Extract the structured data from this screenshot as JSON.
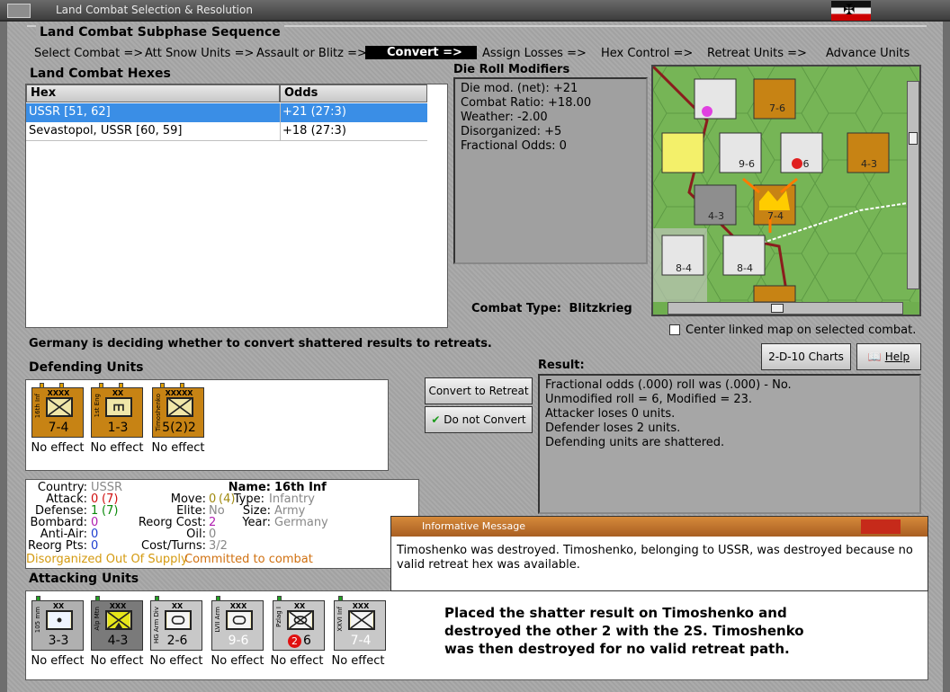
{
  "window": {
    "title": "Land Combat Selection & Resolution"
  },
  "subphase": {
    "title": "Land Combat Subphase Sequence",
    "steps": [
      "Select Combat =>",
      "Att Snow Units =>",
      "Assault or Blitz =>",
      "Convert =>",
      "Assign Losses =>",
      "Hex Control =>",
      "Retreat Units =>",
      "Advance Units"
    ],
    "active_step": "Convert =>"
  },
  "hexes": {
    "title": "Land Combat Hexes",
    "col_hex": "Hex",
    "col_odds": "Odds",
    "rows": [
      {
        "hex": "USSR [51, 62]",
        "odds": "+21 (27:3)"
      },
      {
        "hex": "Sevastopol, USSR [60, 59]",
        "odds": "+18 (27:3)"
      }
    ]
  },
  "die_mods": {
    "title": "Die Roll Modifiers",
    "lines": [
      "Die mod. (net): +21",
      "",
      "Combat Ratio: +18.00",
      "Weather: -2.00",
      "Disorganized: +5",
      "Fractional Odds: 0"
    ]
  },
  "combat_type": {
    "label": "Combat Type:",
    "value": "Blitzkrieg"
  },
  "center_map": "Center linked map on selected combat.",
  "status": "Germany is deciding whether to convert shattered results to retreats.",
  "buttons": {
    "charts": "2-D-10 Charts",
    "help": "Help",
    "convert": "Convert to Retreat",
    "no_convert": "Do not Convert"
  },
  "defending": {
    "title": "Defending Units",
    "units": [
      {
        "side": "16th Inf",
        "size": "XXXX",
        "strength": "7-4",
        "effect": "No effect",
        "color": "#c78314",
        "symbol": "inf"
      },
      {
        "side": "1st Eng",
        "size": "XX",
        "strength": "1-3",
        "effect": "No effect",
        "color": "#c78314",
        "symbol": "eng"
      },
      {
        "side": "Timoshenko",
        "size": "XXXXX",
        "strength": "5(2)2",
        "effect": "No effect",
        "color": "#c78314",
        "symbol": "inf"
      }
    ]
  },
  "result": {
    "title": "Result:",
    "lines": [
      "Fractional odds (.000) roll was (.000)  - No.",
      "Unmodified roll = 6, Modified = 23.",
      "Attacker loses 0 units.",
      "Defender loses 2 units.",
      "Defending units are shattered."
    ]
  },
  "details": {
    "country_label": "Country:",
    "country": "USSR",
    "attack_label": "Attack:",
    "attack": "0",
    "attack_paren": "(7)",
    "defense_label": "Defense:",
    "defense": "1",
    "defense_paren": "(7)",
    "bombard_label": "Bombard:",
    "bombard": "0",
    "antiair_label": "Anti-Air:",
    "antiair": "0",
    "reorg_label": "Reorg Pts:",
    "reorg": "0",
    "name_label": "Name:",
    "name": "16th Inf",
    "move_label": "Move:",
    "move": "0",
    "move_paren": "(4)",
    "type_label": "Type:",
    "type": "Infantry",
    "elite_label": "Elite:",
    "elite": "No",
    "size_label": "Size:",
    "size": "Army",
    "reorgcost_label": "Reorg Cost:",
    "reorgcost": "2",
    "year_label": "Year:",
    "year": "Germany",
    "oil_label": "Oil:",
    "oil": "0",
    "costturns_label": "Cost/Turns:",
    "costturns": "3/2",
    "status1": "Disorganized Out Of Supply",
    "status2": "Committed to combat"
  },
  "attacking": {
    "title": "Attacking Units",
    "units": [
      {
        "side": "105 mm",
        "size": "XX",
        "strength": "3-3",
        "effect": "No effect"
      },
      {
        "side": "Alp Mtn",
        "size": "XXX",
        "strength": "4-3",
        "effect": "No effect"
      },
      {
        "side": "HG Arm Div",
        "size": "XX",
        "strength": "2-6",
        "effect": "No effect"
      },
      {
        "side": "LVII Arm",
        "size": "XXX",
        "strength": "9-6",
        "effect": "No effect"
      },
      {
        "side": "Pzlag I",
        "size": "XX",
        "strength": "6",
        "strength_badge": "2",
        "effect": "No effect"
      },
      {
        "side": "XXVI Inf",
        "size": "XXX",
        "strength": "7-4",
        "effect": "No effect"
      }
    ]
  },
  "message": {
    "title": "Informative Message",
    "text": "Timoshenko was destroyed.  Timoshenko, belonging to USSR, was destroyed because no valid retreat hex was available."
  },
  "note": [
    "Placed the shatter result on Timoshenko and",
    "destroyed the other 2 with the 2S.  Timoshenko",
    "was then destroyed for no valid retreat path."
  ]
}
